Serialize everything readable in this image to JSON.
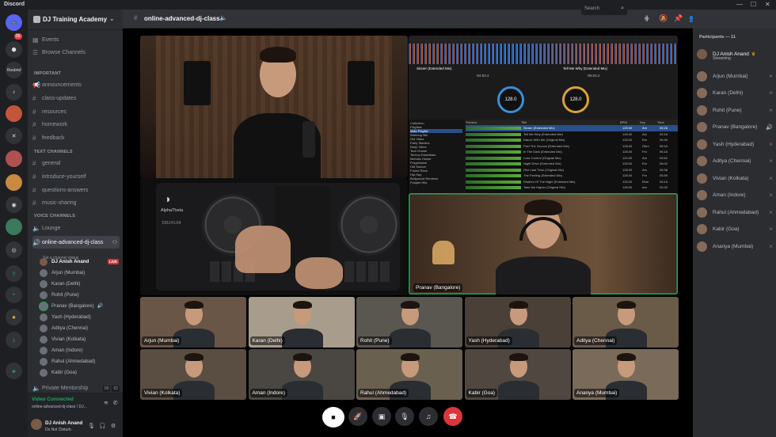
{
  "app": {
    "title": "Discord"
  },
  "rail": {
    "badge": "99",
    "servers": [
      "Roobnd"
    ]
  },
  "guild": {
    "name": "DJ Training Academy"
  },
  "sidebar": {
    "top": [
      {
        "label": "Events"
      },
      {
        "label": "Browse Channels"
      }
    ],
    "important_cat": "IMPORTANT",
    "important": [
      "announcements",
      "class-updates",
      "resources",
      "homework",
      "feedback"
    ],
    "text_cat": "TEXT CHANNELS",
    "text": [
      "general",
      "introduce-yourself",
      "questions-answers",
      "music-sharing"
    ],
    "voice_cat": "VOICE CHANNELS",
    "voice": {
      "lounge": "Lounge",
      "active": "online-advanced-dj-class",
      "status": "Set a channel status",
      "users": [
        "DJ Anish Anand",
        "Arjun (Mumbai)",
        "Karan (Delhi)",
        "Rohit (Pune)",
        "Pranav (Bangalore)",
        "Yash (Hyderabad)",
        "Aditya (Chennai)",
        "Vivian (Kolkata)",
        "Aman (Indore)",
        "Rahul (Ahmedabad)",
        "Kabir (Goa)"
      ],
      "live": "LIVE",
      "private": "Private Mentorship",
      "private_counts": [
        "00",
        "02"
      ]
    }
  },
  "voice_bar": {
    "status": "Video Connected",
    "channel": "online-advanced-dj-class / DJ..."
  },
  "user_bar": {
    "name": "DJ Anish Anand",
    "status": "Do Not Disturb"
  },
  "header": {
    "channel": "online-advanced-dj-class",
    "search_placeholder": "Search"
  },
  "stage": {
    "speaker_tile": "Pranav (Bangalore)",
    "controller_brand": "AlphaTheta",
    "controller_model": "DDJ-FLX4",
    "dj_software": {
      "deck1_track": "Sinner (Extended Mix)",
      "deck1_time": "-04:53.4",
      "deck1_bpm": "128.0",
      "deck2_track": "Tell Me Why (Extended Mix)",
      "deck2_time": "-05:04.2",
      "deck2_bpm": "128.0",
      "tree": [
        "Collection",
        "Playlists",
        "Main Playlist",
        "Warmup Mix",
        "Old Vibes",
        "Party Starters",
        "Deep Vibes",
        "Tech House",
        "Techno Essentials",
        "Melodic House",
        "Progressive",
        "Old School",
        "Future Rave",
        "Hip Hop",
        "Bollywood Remixes",
        "Punjabi Hits"
      ],
      "columns": [
        "Preview",
        "Title",
        "BPM",
        "Key",
        "Time"
      ],
      "tracks": [
        [
          "Sinner (Extended Mix)",
          "128.00",
          "Am",
          "05:28"
        ],
        [
          "Tell Me Why (Extended Mix)",
          "128.00",
          "Am",
          "05:18"
        ],
        [
          "Dance With Me (Original Mix)",
          "128.00",
          "Em",
          "05:49"
        ],
        [
          "Feel The Groove (Extended Mix)",
          "128.00",
          "Gbm",
          "05:43"
        ],
        [
          "In The Dark (Extended Mix)",
          "128.00",
          "Fm",
          "06:18"
        ],
        [
          "Lose Control (Original Mix)",
          "129.00",
          "Am",
          "05:52"
        ],
        [
          "Night Drive (Extended Mix)",
          "128.00",
          "Em",
          "06:02"
        ],
        [
          "One Last Time (Original Mix)",
          "128.00",
          "Am",
          "05:38"
        ],
        [
          "The Feeling (Extended Mix)",
          "128.00",
          "Fm",
          "05:59"
        ],
        [
          "Rhythm Of The Night (Extended Mix)",
          "128.00",
          "Ebm",
          "06:15"
        ],
        [
          "Take Me Higher (Original Mix)",
          "128.00",
          "Am",
          "05:40"
        ]
      ]
    },
    "grid": [
      "Arjun (Mumbai)",
      "Karan (Delhi)",
      "Rohit (Pune)",
      "Yash (Hyderabad)",
      "Aditya (Chennai)",
      "Vivian (Kolkata)",
      "Aman (Indore)",
      "Rahul (Ahmedabad)",
      "Kabir (Goa)",
      "Ananya (Mumbai)"
    ]
  },
  "members": {
    "title": "Participants — 11",
    "host": {
      "name": "DJ Anish Anand",
      "status": "Streaming"
    },
    "list": [
      "Arjun (Mumbai)",
      "Karan (Delhi)",
      "Rohit (Pune)",
      "Pranav (Bangalore)",
      "Yash (Hyderabad)",
      "Aditya (Chennai)",
      "Vivian (Kolkata)",
      "Aman (Indore)",
      "Rahul (Ahmedabad)",
      "Kabir (Goa)",
      "Ananya (Mumbai)"
    ]
  },
  "colors": {
    "accent": "#5865f2",
    "speaking": "#23a55a",
    "live": "#da373c",
    "hangup": "#da373c"
  }
}
